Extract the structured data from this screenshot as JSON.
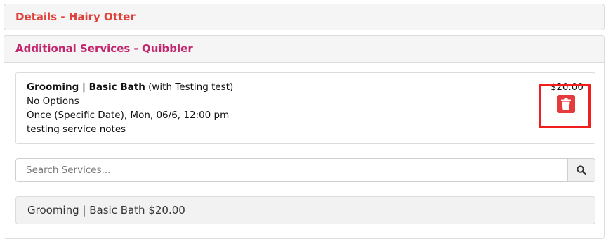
{
  "details_panel": {
    "title": "Details - Hairy Otter"
  },
  "additional_services": {
    "title": "Additional Services - Quibbler",
    "service": {
      "name": "Grooming | Basic Bath",
      "with": " (with Testing test)",
      "options": "No Options",
      "schedule": "Once (Specific Date), Mon, 06/6, 12:00 pm",
      "notes": "testing service notes",
      "price": "$20.00"
    },
    "search": {
      "placeholder": "Search Services..."
    },
    "results": [
      {
        "label": "Grooming | Basic Bath $20.00"
      }
    ]
  },
  "colors": {
    "details_title": "#e0403a",
    "additional_title": "#c2266e",
    "trash_button": "#e63b3b",
    "highlight": "#f21d1d"
  },
  "icons": {
    "delete": "trash-icon",
    "search": "search-icon"
  }
}
